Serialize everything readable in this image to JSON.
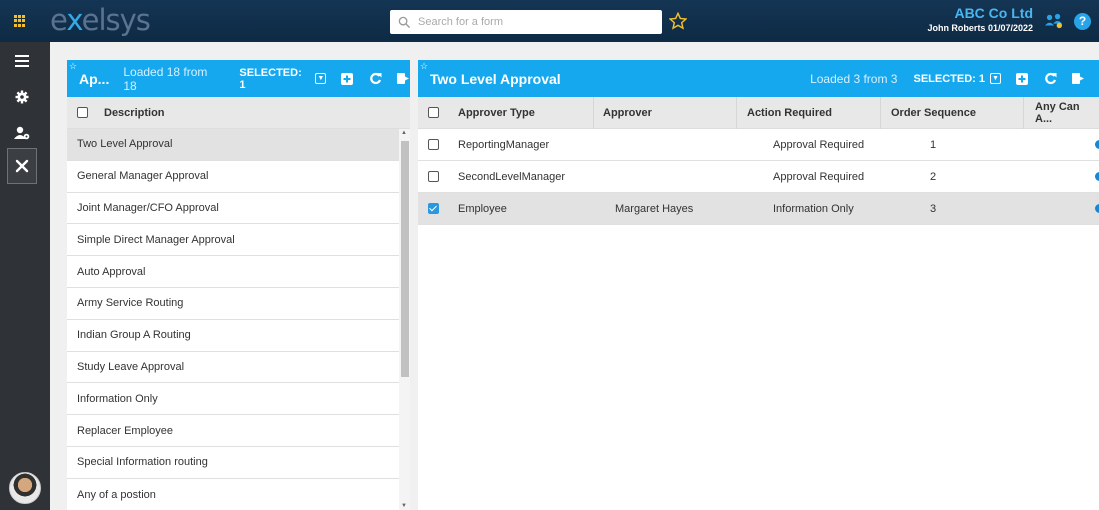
{
  "app": {
    "logo": "exelsys",
    "search_placeholder": "Search for a form",
    "company": "ABC Co Ltd",
    "user_line": "John Roberts 01/07/2022"
  },
  "left_panel": {
    "title": "Ap...",
    "loaded": "Loaded 18 from 18",
    "selected": "SELECTED: 1",
    "column_header": "Description",
    "rows": [
      "Two Level Approval",
      "General Manager Approval",
      "Joint Manager/CFO Approval",
      "Simple Direct Manager Approval",
      "Auto Approval",
      "Army Service Routing",
      "Indian Group A Routing",
      "Study Leave Approval",
      "Information Only",
      "Replacer Employee",
      "Special Information routing",
      "Any of a postion"
    ]
  },
  "right_panel": {
    "title": "Two Level Approval",
    "loaded": "Loaded 3 from 3",
    "selected": "SELECTED: 1",
    "columns": [
      "Approver Type",
      "Approver",
      "Action Required",
      "Order Sequence",
      "Any Can A..."
    ],
    "rows": [
      {
        "type": "ReportingManager",
        "approver": "",
        "action": "Approval Required",
        "order": "1",
        "checked": false
      },
      {
        "type": "SecondLevelManager",
        "approver": "",
        "action": "Approval Required",
        "order": "2",
        "checked": false
      },
      {
        "type": "Employee",
        "approver": "Margaret Hayes",
        "action": "Information Only",
        "order": "3",
        "checked": true
      }
    ]
  },
  "colors": {
    "accent": "#16a8ef",
    "topbar": "#143554",
    "sidenav": "#2f3236"
  }
}
